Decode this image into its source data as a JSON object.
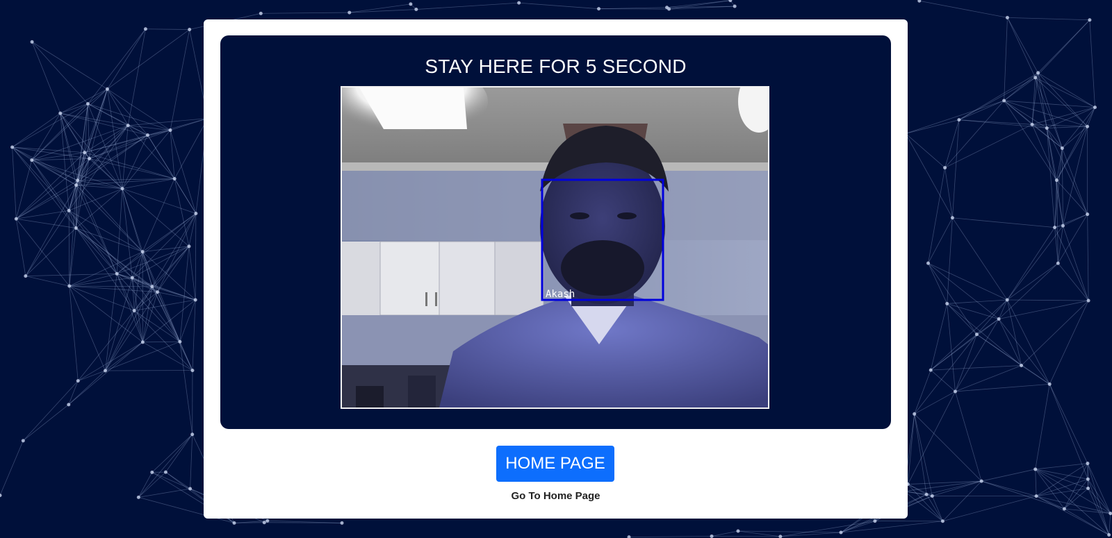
{
  "page": {
    "background_color": "#00103a",
    "accent_color": "#0d6efd"
  },
  "panel": {
    "title": "STAY HERE FOR 5 SECOND"
  },
  "camera": {
    "detected_face_label": "Akash",
    "detection_box_color": "#0000dd"
  },
  "actions": {
    "home_button_label": "HOME PAGE",
    "home_caption": "Go To Home Page"
  }
}
